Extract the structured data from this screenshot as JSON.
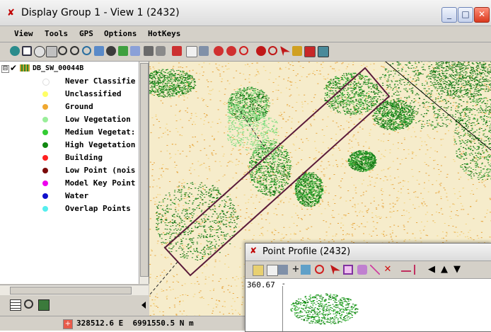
{
  "window": {
    "title": "Display Group 1 - View 1 (2432)",
    "controls": {
      "minimize": "_",
      "maximize": "□",
      "close": "✕"
    }
  },
  "menu": [
    "View",
    "Tools",
    "GPS",
    "Options",
    "HotKeys"
  ],
  "layer": {
    "name": "DB_SW_00044B",
    "expander": "⊟",
    "classes": [
      {
        "label": "Never Classifie",
        "color": "#ffffff"
      },
      {
        "label": "Unclassified",
        "color": "#ffff66"
      },
      {
        "label": "Ground",
        "color": "#f0a830"
      },
      {
        "label": "Low Vegetation",
        "color": "#99ee99"
      },
      {
        "label": "Medium Vegetat:",
        "color": "#33cc33"
      },
      {
        "label": "High Vegetation",
        "color": "#118811"
      },
      {
        "label": "Building",
        "color": "#ff2020"
      },
      {
        "label": "Low Point (nois",
        "color": "#7a0a0a"
      },
      {
        "label": "Model Key Point",
        "color": "#ee00ee"
      },
      {
        "label": "Water",
        "color": "#1010cc"
      },
      {
        "label": "Overlap Points",
        "color": "#55eeee"
      }
    ]
  },
  "status": {
    "easting": "328512.6 E",
    "northing": "6991550.5 N m"
  },
  "profile": {
    "title": "Point Profile (2432)",
    "elevation_label": "360.67",
    "toolbar_glyphs": [
      "+",
      "◀",
      "▲",
      "▼"
    ]
  }
}
